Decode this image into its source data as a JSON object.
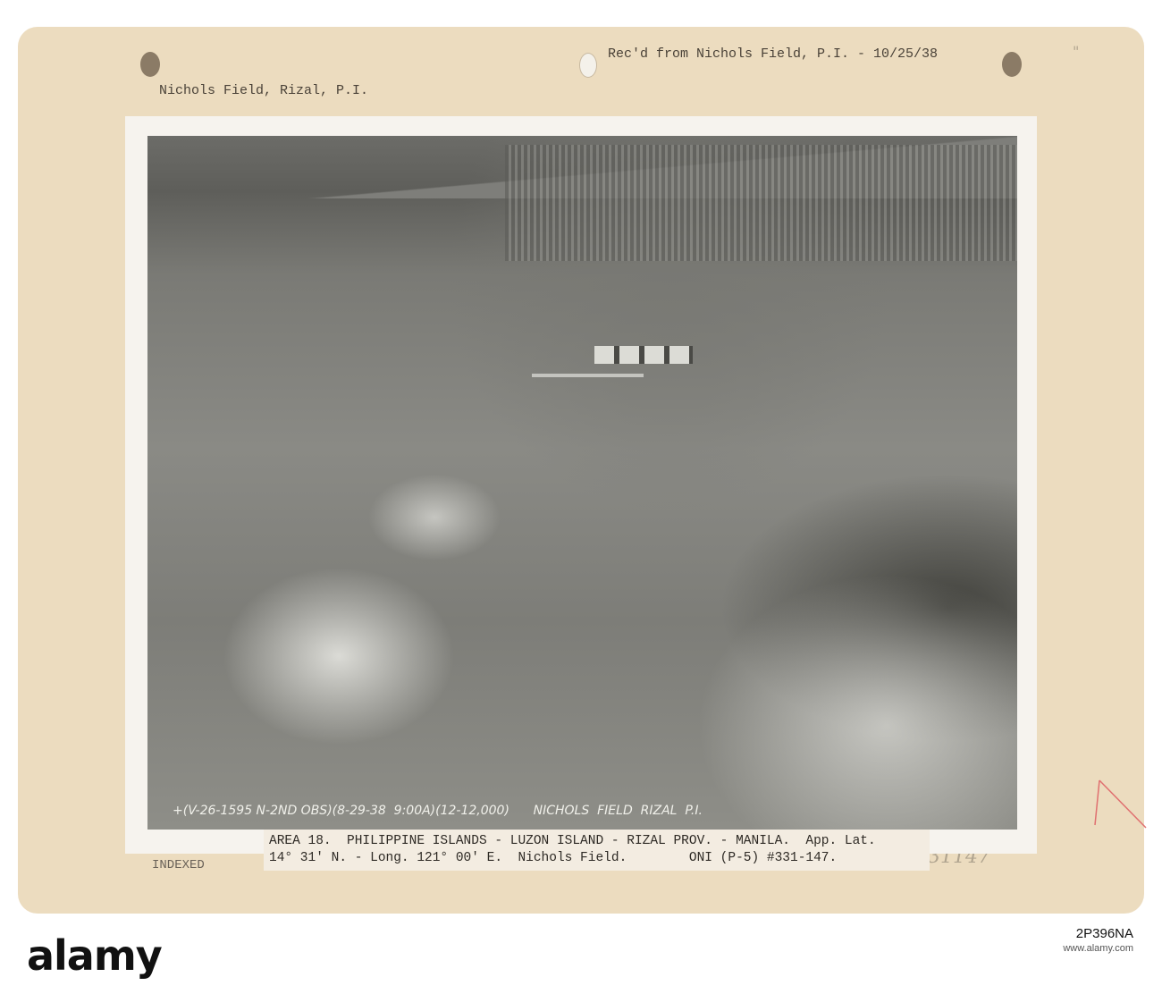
{
  "card": {
    "received_note": "Rec'd from Nichols Field, P.I. - 10/25/38",
    "location_heading": "Nichols Field, Rizal, P.I.",
    "corner_mark": "\"",
    "indexed_stamp": "INDEXED",
    "handwritten_number": "31147"
  },
  "photo": {
    "negative_caption": "+(V-26-1595 N-2ND OBS)(8-29-38  9:00A)(12-12,000)      NICHOLS  FIELD  RIZAL  P.I."
  },
  "label": {
    "line1": "AREA 18.  PHILIPPINE ISLANDS - LUZON ISLAND - RIZAL PROV. - MANILA.  App. Lat.",
    "line2": "14° 31' N. - Long. 121° 00' E.  Nichols Field.        ONI (P-5) #331-147."
  },
  "footer": {
    "logo": "alamy",
    "image_id": "2P396NA",
    "site": "www.alamy.com"
  }
}
